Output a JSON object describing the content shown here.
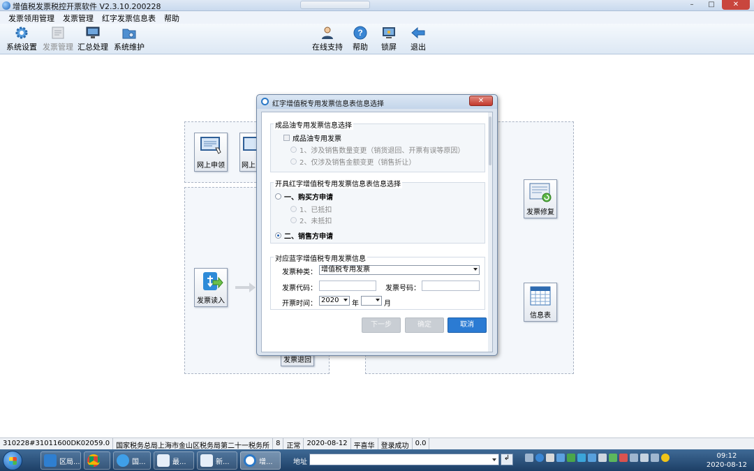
{
  "window": {
    "title": "增值税发票税控开票软件 V2.3.10.200228",
    "minimize": "–",
    "maximize": "□",
    "close": "✕"
  },
  "menu": [
    "发票领用管理",
    "发票管理",
    "红字发票信息表",
    "帮助"
  ],
  "toolbar": {
    "left": [
      {
        "label": "系统设置",
        "icon": "gear-icon",
        "enabled": true
      },
      {
        "label": "发票管理",
        "icon": "invoice-icon",
        "enabled": false
      },
      {
        "label": "汇总处理",
        "icon": "monitor-icon",
        "enabled": true
      },
      {
        "label": "系统维护",
        "icon": "folder-gear-icon",
        "enabled": true
      }
    ],
    "right": [
      {
        "label": "在线支持",
        "icon": "person-icon"
      },
      {
        "label": "帮助",
        "icon": "help-icon"
      },
      {
        "label": "锁屏",
        "icon": "lock-screen-icon"
      },
      {
        "label": "退出",
        "icon": "exit-arrow-icon"
      }
    ]
  },
  "features": {
    "online_apply": "网上申领",
    "online_second": "网上",
    "invoice_read": "发票读入",
    "invoice_return": "发票退回",
    "invoice_repair": "发票修复",
    "info_table": "信息表"
  },
  "dialog": {
    "title": "红字增值税专用发票信息表信息选择",
    "close": "✕",
    "section1": {
      "title": "成品油专用发票信息选择",
      "checkbox_label": "成品油专用发票",
      "option1": "1、涉及销售数量变更（销货退回、开票有误等原因）",
      "option2": "2、仅涉及销售金额变更（销售折让）"
    },
    "section2": {
      "title": "开具红字增值税专用发票信息表信息选择",
      "buyer": "一、购买方申请",
      "sub1": "1、已抵扣",
      "sub2": "2、未抵扣",
      "seller": "二、销售方申请"
    },
    "section3": {
      "title": "对应蓝字增值税专用发票信息",
      "type_label": "发票种类：",
      "type_value": "增值税专用发票",
      "code_label": "发票代码：",
      "code_value": "",
      "number_label": "发票号码：",
      "number_value": "",
      "date_label": "开票时间：",
      "year_value": "2020",
      "year_unit": "年",
      "month_value": "",
      "month_unit": "月"
    },
    "buttons": {
      "next": "下一步",
      "confirm": "确定",
      "cancel": "取消"
    }
  },
  "statusbar": [
    "310228#31011600DK02059.0",
    "国家税务总局上海市金山区税务局第二十一税务所",
    "8",
    "正常",
    "2020-08-12",
    "平喜华",
    "登录成功",
    "0.0"
  ],
  "taskbar": {
    "tasks": [
      {
        "label": "区局...",
        "icon": "qq-icon",
        "active": false
      },
      {
        "label": "",
        "icon": "chrome-icon",
        "active": false
      },
      {
        "label": "国...",
        "icon": "ie-icon",
        "active": false
      },
      {
        "label": "最...",
        "icon": "word-icon",
        "active": false
      },
      {
        "label": "新...",
        "icon": "word-icon",
        "active": false
      },
      {
        "label": "增...",
        "icon": "tax-app-icon",
        "active": true
      }
    ],
    "address_label": "地址",
    "address_value": "",
    "go": "↲",
    "time": "09:12",
    "date": "2020-08-12"
  }
}
